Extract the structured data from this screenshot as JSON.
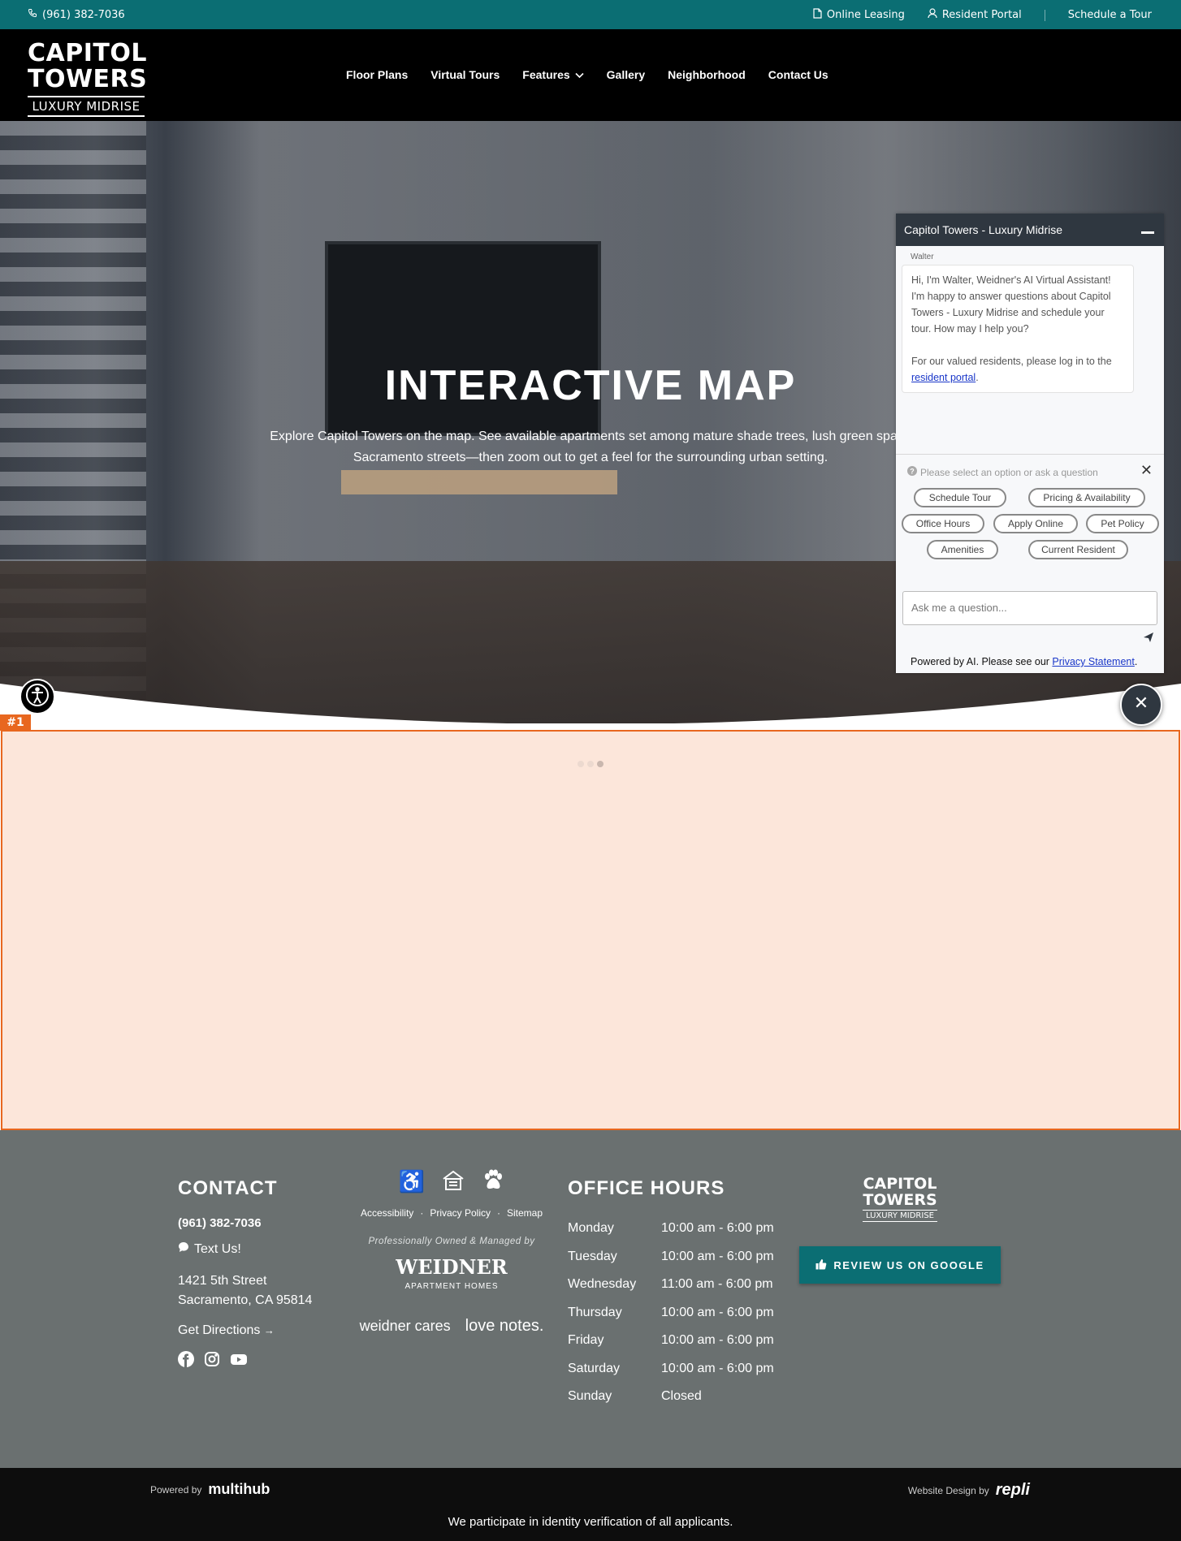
{
  "topbar": {
    "phone": "(961) 382-7036",
    "online_leasing": "Online Leasing",
    "resident_portal": "Resident Portal",
    "schedule_tour": "Schedule a Tour"
  },
  "logo": {
    "line1": "CAPITOL",
    "line2": "TOWERS",
    "line3": "LUXURY MIDRISE"
  },
  "nav": {
    "items": [
      "Floor Plans",
      "Virtual Tours",
      "Features",
      "Gallery",
      "Neighborhood",
      "Contact Us"
    ]
  },
  "hero": {
    "title": "INTERACTIVE MAP",
    "subtitle_line1": "Explore Capitol Towers on the map. See available apartments set among mature shade trees, lush green space",
    "subtitle_line2": "Sacramento streets—then zoom out to get a feel for the surrounding urban setting."
  },
  "highlight_tag": "#1",
  "chat": {
    "title": "Capitol Towers - Luxury Midrise",
    "agent": "Walter",
    "message_p1": "Hi, I'm Walter, Weidner's AI Virtual Assistant! I'm happy to answer questions about Capitol Towers - Luxury Midrise and schedule your tour. How may I help you?",
    "message_p2_prefix": "For our valued residents, please log in to the ",
    "message_p2_link": "resident portal",
    "message_p2_suffix": ".",
    "prompt": "Please select an option or ask a question",
    "chips": [
      "Schedule Tour",
      "Pricing & Availability",
      "Office Hours",
      "Apply Online",
      "Pet Policy",
      "Amenities",
      "Current Resident"
    ],
    "input_placeholder": "Ask me a question...",
    "footer_prefix": "Powered by AI. Please see our ",
    "footer_link": "Privacy Statement",
    "footer_suffix": "."
  },
  "footer": {
    "contact_heading": "CONTACT",
    "phone": "(961) 382-7036",
    "text_us": "Text Us!",
    "address_line1": "1421 5th Street",
    "address_line2": "Sacramento, CA 95814",
    "directions": "Get Directions",
    "links": [
      "Accessibility",
      "Privacy Policy",
      "Sitemap"
    ],
    "managed_by": "Professionally Owned & Managed by",
    "weidner": "WEIDNER",
    "weidner_sub": "APARTMENT HOMES",
    "weidner_cares": "weidner cares",
    "love_notes": "love notes.",
    "hours_heading": "OFFICE HOURS",
    "hours": [
      {
        "day": "Monday",
        "time": "10:00 am - 6:00 pm"
      },
      {
        "day": "Tuesday",
        "time": "10:00 am - 6:00 pm"
      },
      {
        "day": "Wednesday",
        "time": "11:00 am - 6:00 pm"
      },
      {
        "day": "Thursday",
        "time": "10:00 am - 6:00 pm"
      },
      {
        "day": "Friday",
        "time": "10:00 am - 6:00 pm"
      },
      {
        "day": "Saturday",
        "time": "10:00 am - 6:00 pm"
      },
      {
        "day": "Sunday",
        "time": "Closed"
      }
    ],
    "review_button": "REVIEW US ON GOOGLE"
  },
  "bottom": {
    "powered_by": "Powered by",
    "powered_brand": "multihub",
    "design_by": "Website Design by",
    "design_brand": "repli",
    "identity": "We participate in identity verification of all applicants."
  },
  "colors": {
    "teal": "#0b6e73",
    "header": "#000000",
    "footer": "#6a7070",
    "highlight": "#e8671f",
    "chat_header": "#2f3740"
  }
}
